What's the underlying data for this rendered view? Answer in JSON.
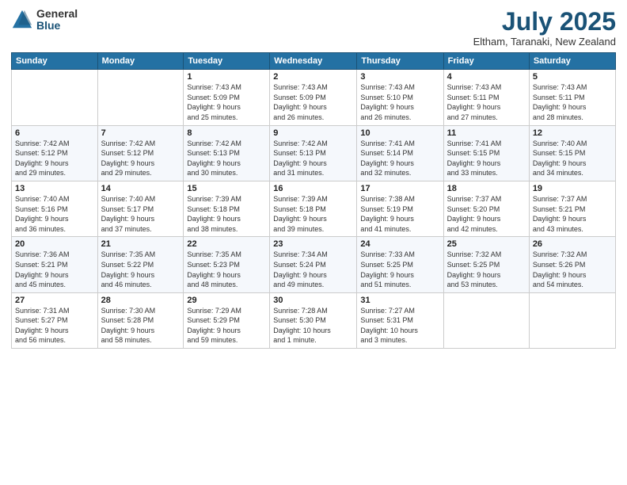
{
  "logo": {
    "general": "General",
    "blue": "Blue"
  },
  "header": {
    "title": "July 2025",
    "subtitle": "Eltham, Taranaki, New Zealand"
  },
  "days": [
    "Sunday",
    "Monday",
    "Tuesday",
    "Wednesday",
    "Thursday",
    "Friday",
    "Saturday"
  ],
  "weeks": [
    [
      {
        "day": "",
        "content": ""
      },
      {
        "day": "",
        "content": ""
      },
      {
        "day": "1",
        "content": "Sunrise: 7:43 AM\nSunset: 5:09 PM\nDaylight: 9 hours\nand 25 minutes."
      },
      {
        "day": "2",
        "content": "Sunrise: 7:43 AM\nSunset: 5:09 PM\nDaylight: 9 hours\nand 26 minutes."
      },
      {
        "day": "3",
        "content": "Sunrise: 7:43 AM\nSunset: 5:10 PM\nDaylight: 9 hours\nand 26 minutes."
      },
      {
        "day": "4",
        "content": "Sunrise: 7:43 AM\nSunset: 5:11 PM\nDaylight: 9 hours\nand 27 minutes."
      },
      {
        "day": "5",
        "content": "Sunrise: 7:43 AM\nSunset: 5:11 PM\nDaylight: 9 hours\nand 28 minutes."
      }
    ],
    [
      {
        "day": "6",
        "content": "Sunrise: 7:42 AM\nSunset: 5:12 PM\nDaylight: 9 hours\nand 29 minutes."
      },
      {
        "day": "7",
        "content": "Sunrise: 7:42 AM\nSunset: 5:12 PM\nDaylight: 9 hours\nand 29 minutes."
      },
      {
        "day": "8",
        "content": "Sunrise: 7:42 AM\nSunset: 5:13 PM\nDaylight: 9 hours\nand 30 minutes."
      },
      {
        "day": "9",
        "content": "Sunrise: 7:42 AM\nSunset: 5:13 PM\nDaylight: 9 hours\nand 31 minutes."
      },
      {
        "day": "10",
        "content": "Sunrise: 7:41 AM\nSunset: 5:14 PM\nDaylight: 9 hours\nand 32 minutes."
      },
      {
        "day": "11",
        "content": "Sunrise: 7:41 AM\nSunset: 5:15 PM\nDaylight: 9 hours\nand 33 minutes."
      },
      {
        "day": "12",
        "content": "Sunrise: 7:40 AM\nSunset: 5:15 PM\nDaylight: 9 hours\nand 34 minutes."
      }
    ],
    [
      {
        "day": "13",
        "content": "Sunrise: 7:40 AM\nSunset: 5:16 PM\nDaylight: 9 hours\nand 36 minutes."
      },
      {
        "day": "14",
        "content": "Sunrise: 7:40 AM\nSunset: 5:17 PM\nDaylight: 9 hours\nand 37 minutes."
      },
      {
        "day": "15",
        "content": "Sunrise: 7:39 AM\nSunset: 5:18 PM\nDaylight: 9 hours\nand 38 minutes."
      },
      {
        "day": "16",
        "content": "Sunrise: 7:39 AM\nSunset: 5:18 PM\nDaylight: 9 hours\nand 39 minutes."
      },
      {
        "day": "17",
        "content": "Sunrise: 7:38 AM\nSunset: 5:19 PM\nDaylight: 9 hours\nand 41 minutes."
      },
      {
        "day": "18",
        "content": "Sunrise: 7:37 AM\nSunset: 5:20 PM\nDaylight: 9 hours\nand 42 minutes."
      },
      {
        "day": "19",
        "content": "Sunrise: 7:37 AM\nSunset: 5:21 PM\nDaylight: 9 hours\nand 43 minutes."
      }
    ],
    [
      {
        "day": "20",
        "content": "Sunrise: 7:36 AM\nSunset: 5:21 PM\nDaylight: 9 hours\nand 45 minutes."
      },
      {
        "day": "21",
        "content": "Sunrise: 7:35 AM\nSunset: 5:22 PM\nDaylight: 9 hours\nand 46 minutes."
      },
      {
        "day": "22",
        "content": "Sunrise: 7:35 AM\nSunset: 5:23 PM\nDaylight: 9 hours\nand 48 minutes."
      },
      {
        "day": "23",
        "content": "Sunrise: 7:34 AM\nSunset: 5:24 PM\nDaylight: 9 hours\nand 49 minutes."
      },
      {
        "day": "24",
        "content": "Sunrise: 7:33 AM\nSunset: 5:25 PM\nDaylight: 9 hours\nand 51 minutes."
      },
      {
        "day": "25",
        "content": "Sunrise: 7:32 AM\nSunset: 5:25 PM\nDaylight: 9 hours\nand 53 minutes."
      },
      {
        "day": "26",
        "content": "Sunrise: 7:32 AM\nSunset: 5:26 PM\nDaylight: 9 hours\nand 54 minutes."
      }
    ],
    [
      {
        "day": "27",
        "content": "Sunrise: 7:31 AM\nSunset: 5:27 PM\nDaylight: 9 hours\nand 56 minutes."
      },
      {
        "day": "28",
        "content": "Sunrise: 7:30 AM\nSunset: 5:28 PM\nDaylight: 9 hours\nand 58 minutes."
      },
      {
        "day": "29",
        "content": "Sunrise: 7:29 AM\nSunset: 5:29 PM\nDaylight: 9 hours\nand 59 minutes."
      },
      {
        "day": "30",
        "content": "Sunrise: 7:28 AM\nSunset: 5:30 PM\nDaylight: 10 hours\nand 1 minute."
      },
      {
        "day": "31",
        "content": "Sunrise: 7:27 AM\nSunset: 5:31 PM\nDaylight: 10 hours\nand 3 minutes."
      },
      {
        "day": "",
        "content": ""
      },
      {
        "day": "",
        "content": ""
      }
    ]
  ]
}
